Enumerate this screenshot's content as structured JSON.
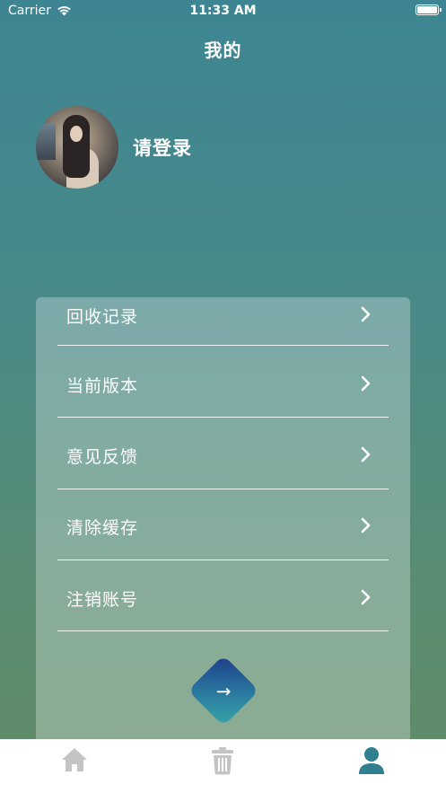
{
  "status_bar": {
    "carrier": "Carrier",
    "time": "11:33 AM"
  },
  "nav": {
    "title": "我的"
  },
  "profile": {
    "login_prompt": "请登录"
  },
  "menu": {
    "items": [
      {
        "label": "回收记录"
      },
      {
        "label": "当前版本"
      },
      {
        "label": "意见反馈"
      },
      {
        "label": "清除缓存"
      },
      {
        "label": "注销账号"
      }
    ]
  },
  "logout": {
    "icon": "→"
  },
  "tab_bar": {
    "tabs": [
      {
        "icon": "home-icon",
        "active": false
      },
      {
        "icon": "trash-icon",
        "active": false
      },
      {
        "icon": "person-icon",
        "active": true
      }
    ],
    "active_color": "#2f7f8e",
    "inactive_color": "#c4c4c4"
  }
}
